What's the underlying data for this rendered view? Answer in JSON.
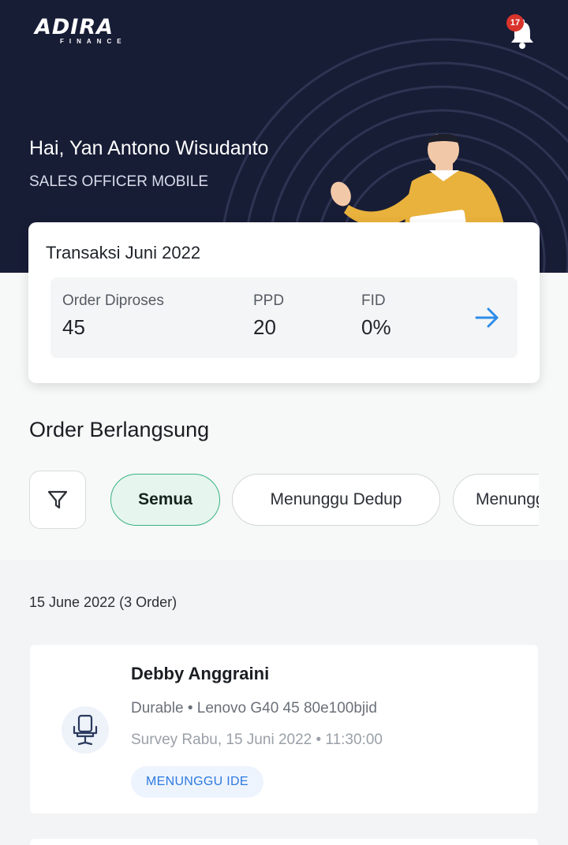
{
  "app": {
    "logo_text": "ADIRA",
    "logo_subtext": "FINANCE",
    "notification_count": "17"
  },
  "user": {
    "greeting": "Hai, Yan Antono Wisudanto",
    "role": "SALES OFFICER MOBILE"
  },
  "transaction": {
    "title": "Transaksi Juni 2022",
    "stats": [
      {
        "label": "Order Diproses",
        "value": "45"
      },
      {
        "label": "PPD",
        "value": "20"
      },
      {
        "label": "FID",
        "value": "0%"
      }
    ]
  },
  "orders": {
    "section_title": "Order Berlangsung",
    "filter_chips": [
      {
        "label": "Semua",
        "active": true
      },
      {
        "label": "Menunggu Dedup",
        "active": false
      },
      {
        "label": "Menunggu Survey",
        "active": false
      }
    ],
    "groups": [
      {
        "date_header": "15 June 2022 (3 Order)",
        "items": [
          {
            "name": "Debby Anggraini",
            "product": "Durable • Lenovo G40 45 80e100bjid",
            "survey": "Survey Rabu, 15 Juni 2022 • 11:30:00",
            "status": "MENUNGGU IDE",
            "icon": "office-chair-icon"
          }
        ]
      }
    ]
  },
  "colors": {
    "header_bg": "#181d36",
    "accent_green": "#39b381",
    "accent_blue": "#2d79e0",
    "badge_red": "#d9342b"
  }
}
